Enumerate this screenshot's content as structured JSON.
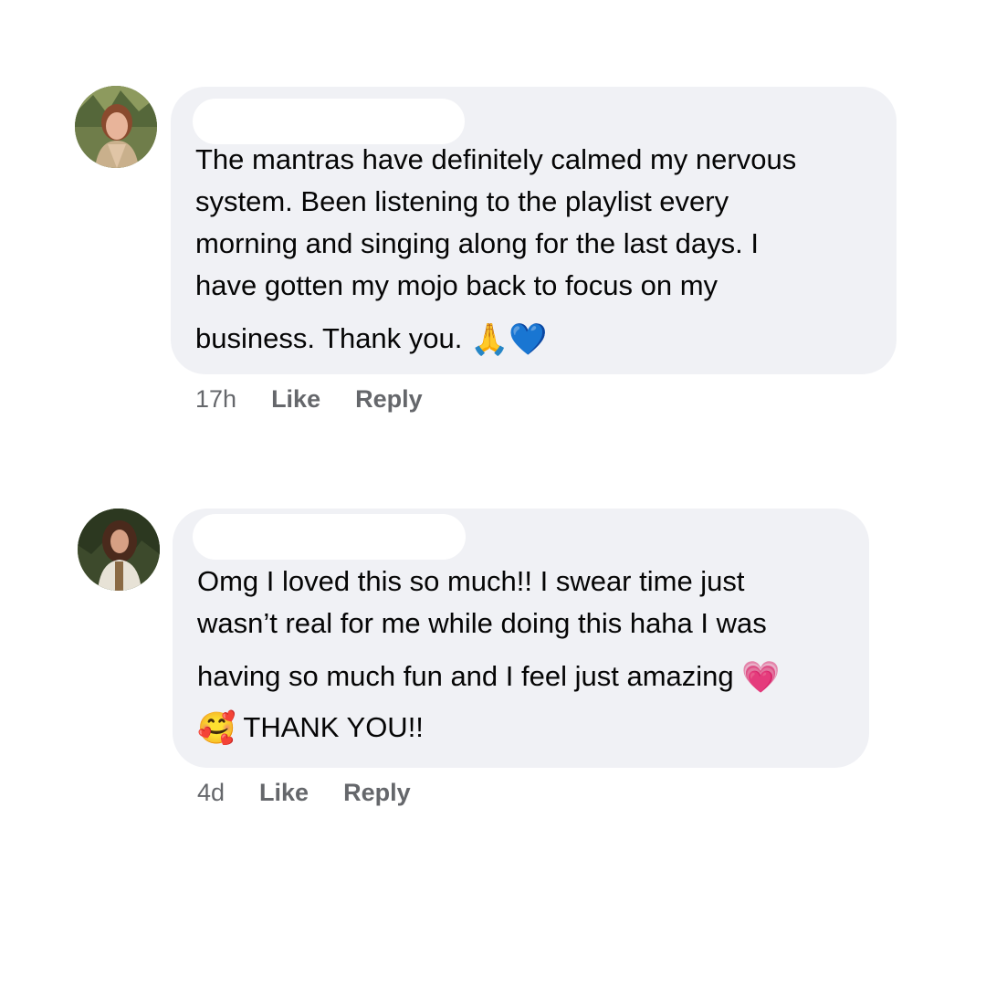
{
  "comments": [
    {
      "avatar": "commenter-avatar-photo",
      "body_lines": [
        "The mantras have definitely calmed my nervous",
        "system. Been listening to the playlist every",
        "morning and singing along for the last days. I",
        "have gotten my mojo back to focus on my",
        "business. Thank you. "
      ],
      "emojis": [
        "🙏",
        "💙"
      ],
      "time": "17h",
      "like_label": "Like",
      "reply_label": "Reply"
    },
    {
      "avatar": "commenter-avatar-photo",
      "body_lines": [
        "Omg I loved this so much!! I swear time just",
        "wasn’t real for me while doing this haha I was",
        "having so much fun and I feel just amazing ",
        " THANK YOU!!"
      ],
      "emojis": [
        "💗",
        "🥰"
      ],
      "time": "4d",
      "like_label": "Like",
      "reply_label": "Reply"
    }
  ],
  "colors": {
    "bubble": "#f0f1f5",
    "text": "#050505",
    "meta": "#65676b",
    "emoji_blue_heart": "#1f8cf0",
    "emoji_pink_heart": "#f0559b"
  }
}
